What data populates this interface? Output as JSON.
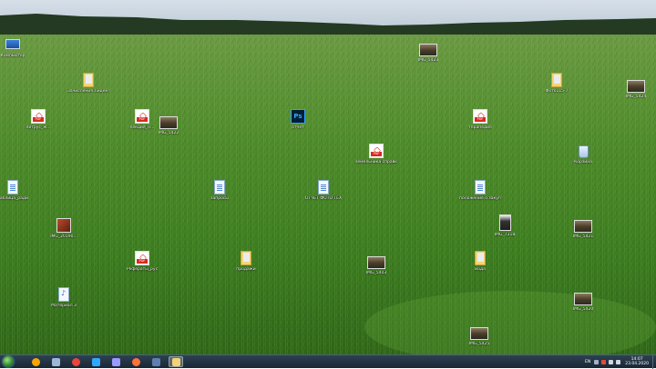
{
  "desktop": {
    "icons": [
      {
        "label": "Компьютер",
        "type": "pc"
      },
      {
        "label": "Зачисления Лицензии",
        "type": "folder"
      },
      {
        "label": "IMG_5423",
        "type": "photo"
      },
      {
        "label": "Фото115-7",
        "type": "folder"
      },
      {
        "label": "IMG_5424",
        "type": "photo"
      },
      {
        "label": "литрус_ж...",
        "type": "pdf"
      },
      {
        "label": "лекция_П...",
        "type": "pdf"
      },
      {
        "label": "IMG_5422",
        "type": "photo"
      },
      {
        "label": "отчет",
        "type": "ps"
      },
      {
        "label": "терапедия",
        "type": "pdf"
      },
      {
        "label": "Корзина",
        "type": "bin"
      },
      {
        "label": "земельника справка",
        "type": "pdf"
      },
      {
        "label": "Таблица_ради",
        "type": "doc"
      },
      {
        "label": "запросы",
        "type": "doc"
      },
      {
        "label": "ОТЧЕТ ФОТО ТЕХ",
        "type": "doc"
      },
      {
        "label": "положение о закупках",
        "type": "doc"
      },
      {
        "label": "IMG_20190...",
        "type": "photo-red"
      },
      {
        "label": "IMG_7218",
        "type": "photo-dark"
      },
      {
        "label": "IMG_5421",
        "type": "photo"
      },
      {
        "label": "Рефераты_рус",
        "type": "pdf"
      },
      {
        "label": "продажи",
        "type": "folder"
      },
      {
        "label": "IMG_5403",
        "type": "photo"
      },
      {
        "label": "Вода",
        "type": "folder"
      },
      {
        "label": "Материал 3",
        "type": "music"
      },
      {
        "label": "IMG_5425",
        "type": "photo"
      },
      {
        "label": "IMG_5420",
        "type": "photo"
      }
    ]
  },
  "taskbar": {
    "pinned": [
      {
        "name": "avast",
        "color": "#f7a600"
      },
      {
        "name": "network-computer",
        "color": "#9cb8d8"
      },
      {
        "name": "chrome",
        "color": "#e8453c"
      },
      {
        "name": "photoshop",
        "color": "#31a8ff"
      },
      {
        "name": "premiere",
        "color": "#9999ff"
      },
      {
        "name": "firefox",
        "color": "#ff7139"
      },
      {
        "name": "save-floppy",
        "color": "#5c7fb0"
      },
      {
        "name": "explorer",
        "color": "#f2d477"
      }
    ],
    "lang": "EN",
    "time": "14:07",
    "date": "23.04.2020"
  },
  "colors": {
    "grass_dark": "#2f5a1c",
    "grass_light": "#6aa342",
    "sky": "#c9d6e1"
  }
}
